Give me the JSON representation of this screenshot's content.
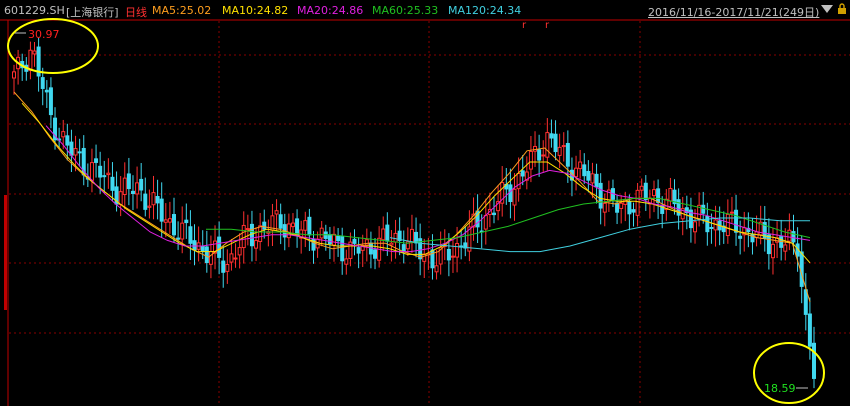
{
  "header": {
    "symbol": "601229.SH",
    "name": "[上海银行]",
    "period": "日线",
    "ma": [
      {
        "label": "MA5:25.02",
        "color": "#ff9e1e"
      },
      {
        "label": "MA10:24.82",
        "color": "#ffe000"
      },
      {
        "label": "MA20:24.86",
        "color": "#e020e0"
      },
      {
        "label": "MA60:25.33",
        "color": "#20c020"
      },
      {
        "label": "MA120:24.34",
        "color": "#40d0e0"
      }
    ],
    "range": "2016/11/16-2017/11/21(249日)",
    "range_menu_icon": "dropdown-triangle-icon",
    "lock_icon": "lock-icon"
  },
  "annotations": {
    "high_label": "30.97",
    "low_label": "18.59",
    "high_color": "#ff2020",
    "low_color": "#20e020",
    "circle_color": "#ffff00"
  },
  "colors": {
    "up": "#ff3030",
    "down": "#40d8f0",
    "grid": "#8a0000",
    "frame": "#c00000",
    "text": "#c0c0c0"
  },
  "chart_data": {
    "type": "candlestick",
    "title": "601229.SH [上海银行] 日线",
    "date_range": [
      "2016/11/16",
      "2017/11/21"
    ],
    "trading_days": 249,
    "yrange_estimate": [
      18.0,
      31.5
    ],
    "high": 30.97,
    "low": 18.59,
    "close_price_path": [
      29.5,
      30.6,
      28.2,
      27.0,
      26.4,
      26.0,
      25.4,
      25.6,
      24.8,
      24.2,
      23.7,
      23.2,
      22.9,
      23.8,
      24.1,
      24.4,
      24.0,
      23.9,
      23.6,
      23.3,
      23.5,
      23.7,
      23.8,
      23.2,
      23.0,
      23.5,
      24.2,
      24.9,
      25.6,
      26.4,
      27.4,
      26.6,
      26.1,
      25.4,
      24.8,
      25.2,
      25.3,
      25.0,
      24.6,
      24.3,
      24.3,
      24.1,
      23.8,
      23.6,
      23.6,
      18.8
    ],
    "moving_averages": {
      "MA5": [
        29.0,
        28.3,
        27.4,
        26.6,
        26.0,
        25.5,
        25.0,
        24.6,
        24.2,
        23.8,
        23.4,
        23.1,
        23.6,
        24.0,
        24.2,
        24.1,
        23.9,
        23.6,
        23.4,
        23.5,
        23.6,
        23.6,
        23.3,
        23.1,
        23.3,
        23.9,
        24.6,
        25.4,
        26.1,
        26.9,
        27.0,
        26.4,
        25.8,
        25.1,
        25.0,
        25.2,
        25.2,
        24.9,
        24.6,
        24.4,
        24.2,
        24.0,
        23.8,
        23.7,
        23.6,
        21.5
      ],
      "MA10": [
        28.6,
        27.9,
        27.1,
        26.4,
        25.8,
        25.3,
        24.8,
        24.4,
        24.0,
        23.6,
        23.3,
        23.3,
        23.6,
        23.9,
        24.1,
        24.0,
        23.8,
        23.6,
        23.5,
        23.5,
        23.5,
        23.4,
        23.2,
        23.2,
        23.5,
        24.0,
        24.6,
        25.3,
        25.9,
        26.5,
        26.5,
        26.1,
        25.6,
        25.2,
        25.1,
        25.1,
        25.0,
        24.8,
        24.6,
        24.4,
        24.2,
        24.0,
        23.9,
        23.8,
        23.6,
        22.9
      ],
      "MA20": [
        27.8,
        27.1,
        26.3,
        25.6,
        25.0,
        24.5,
        24.0,
        23.7,
        23.5,
        23.5,
        23.6,
        23.7,
        23.8,
        23.9,
        23.9,
        23.8,
        23.7,
        23.6,
        23.5,
        23.4,
        23.3,
        23.3,
        23.4,
        23.6,
        23.9,
        24.4,
        25.0,
        25.6,
        26.0,
        26.2,
        26.1,
        25.8,
        25.5,
        25.3,
        25.2,
        25.0,
        24.9,
        24.7,
        24.6,
        24.4,
        24.2,
        24.0,
        23.9,
        23.8,
        23.7
      ],
      "MA60": [
        24.1,
        24.1,
        24.0,
        24.0,
        23.9,
        23.9,
        23.8,
        23.7,
        23.6,
        23.7,
        23.8,
        24.0,
        24.2,
        24.5,
        24.8,
        25.0,
        25.1,
        25.2,
        25.2,
        25.0,
        24.8,
        24.6,
        24.3,
        24.0,
        23.8
      ],
      "MA120": [
        23.8,
        23.6,
        23.5,
        23.4,
        23.3,
        23.3,
        23.5,
        23.8,
        24.1,
        24.3,
        24.4,
        24.5,
        24.5,
        24.4,
        24.4
      ]
    }
  }
}
